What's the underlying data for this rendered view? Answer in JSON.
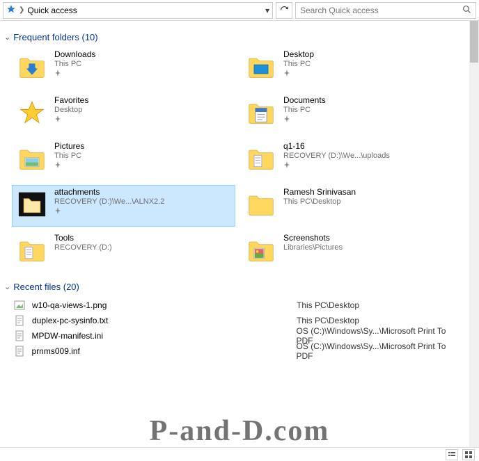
{
  "toolbar": {
    "address": "Quick access",
    "search_placeholder": "Search Quick access"
  },
  "groups": {
    "frequent_label": "Frequent folders (10)",
    "recent_label": "Recent files (20)"
  },
  "folders": [
    {
      "name": "Downloads",
      "path": "This PC",
      "pinned": true,
      "icon": "downloads"
    },
    {
      "name": "Desktop",
      "path": "This PC",
      "pinned": true,
      "icon": "desktop"
    },
    {
      "name": "Favorites",
      "path": "Desktop",
      "pinned": true,
      "icon": "favorites"
    },
    {
      "name": "Documents",
      "path": "This PC",
      "pinned": true,
      "icon": "documents"
    },
    {
      "name": "Pictures",
      "path": "This PC",
      "pinned": true,
      "icon": "pictures"
    },
    {
      "name": "q1-16",
      "path": "RECOVERY (D:)\\We...\\uploads",
      "pinned": true,
      "icon": "folder-docs"
    },
    {
      "name": "attachments",
      "path": "RECOVERY (D:)\\We...\\ALNX2.2",
      "pinned": true,
      "icon": "folder-dark",
      "selected": true
    },
    {
      "name": "Ramesh Srinivasan",
      "path": "This PC\\Desktop",
      "pinned": false,
      "icon": "folder"
    },
    {
      "name": "Tools",
      "path": "RECOVERY (D:)",
      "pinned": false,
      "icon": "folder-docs"
    },
    {
      "name": "Screenshots",
      "path": "Libraries\\Pictures",
      "pinned": false,
      "icon": "folder-pics"
    }
  ],
  "recent": [
    {
      "name": "w10-qa-views-1.png",
      "path": "This PC\\Desktop",
      "icon": "image"
    },
    {
      "name": "duplex-pc-sysinfo.txt",
      "path": "This PC\\Desktop",
      "icon": "text"
    },
    {
      "name": "MPDW-manifest.ini",
      "path": "OS (C:)\\Windows\\Sy...\\Microsoft Print To PDF",
      "icon": "ini"
    },
    {
      "name": "prnms009.inf",
      "path": "OS (C:)\\Windows\\Sy...\\Microsoft Print To PDF",
      "icon": "ini"
    }
  ],
  "watermark": "P-and-D.com"
}
